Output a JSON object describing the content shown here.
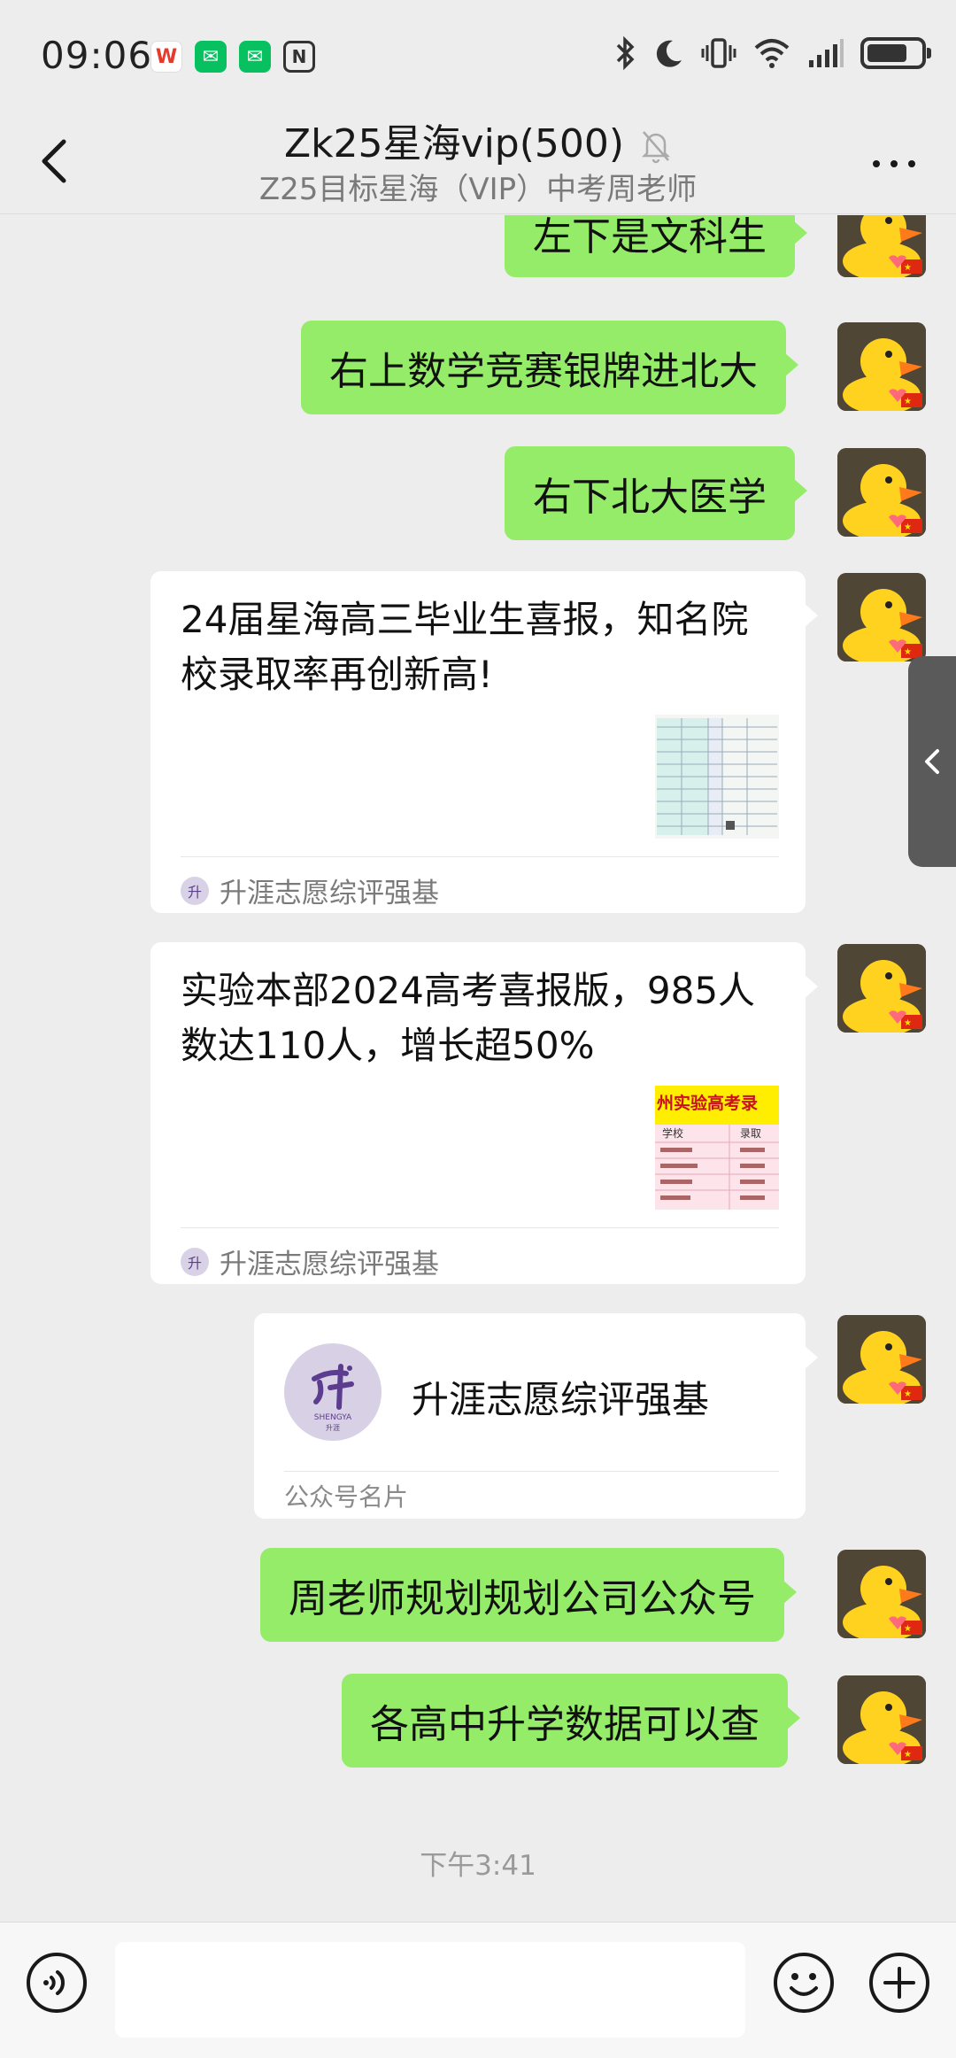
{
  "status_bar": {
    "time": "09:06",
    "battery_level": 0.75,
    "app_icons": [
      "wps-office-icon",
      "wechat-icon",
      "wechat-icon",
      "nfc-icon"
    ],
    "system_icons": [
      "bluetooth-icon",
      "do-not-disturb-icon",
      "vibrate-icon",
      "wifi-icon",
      "signal-icon",
      "battery-icon"
    ]
  },
  "header": {
    "title": "Zk25星海vip(500)",
    "subtitle": "Z25目标星海（VIP）中考周老师"
  },
  "messages": {
    "m1": "左下是文科生",
    "m2": "右上数学竞赛银牌进北大",
    "m3": "右下北大医学",
    "m7": "周老师规划规划公司公众号",
    "m8": "各高中升学数据可以查"
  },
  "article1": {
    "title": "24届星海高三毕业生喜报，知名院校录取率再创新高!",
    "source": "升涯志愿综评强基"
  },
  "article2": {
    "title": "实验本部2024高考喜报版，985人数达110人，增长超50%",
    "source": "升涯志愿综评强基",
    "thumb_header": "州实验高考录",
    "thumb_cols": [
      "学校",
      "录取"
    ]
  },
  "account_card": {
    "name": "升涯志愿综评强基",
    "logo_text": "SHENGYA",
    "logo_sub": "升涯",
    "footer": "公众号名片"
  },
  "timestamp": "下午3:41",
  "input": {
    "placeholder": ""
  },
  "colors": {
    "bubble_green": "#95ec69",
    "background": "#ededed",
    "wechat_green": "#07c160"
  }
}
